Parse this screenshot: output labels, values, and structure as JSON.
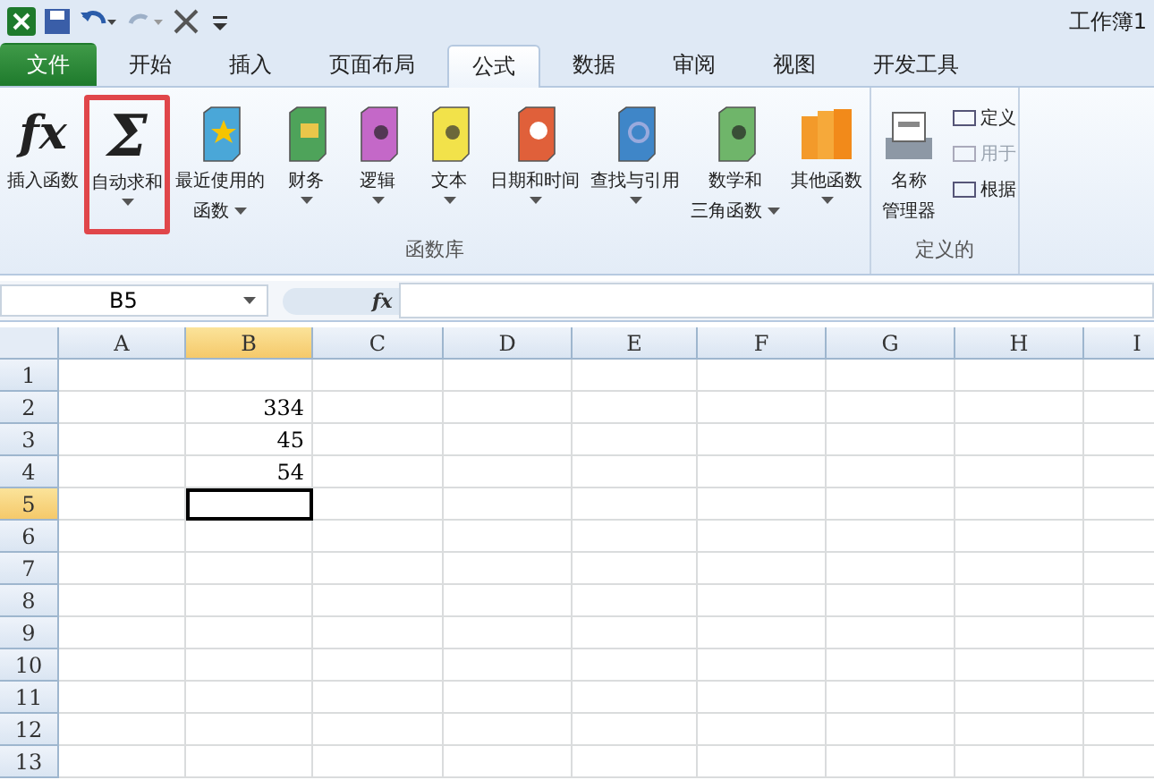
{
  "window": {
    "title": "工作簿1"
  },
  "tabs": [
    {
      "label": "文件",
      "kind": "file",
      "selected": false
    },
    {
      "label": "开始",
      "kind": "tab",
      "selected": false
    },
    {
      "label": "插入",
      "kind": "tab",
      "selected": false
    },
    {
      "label": "页面布局",
      "kind": "tab",
      "selected": false
    },
    {
      "label": "公式",
      "kind": "tab",
      "selected": true
    },
    {
      "label": "数据",
      "kind": "tab",
      "selected": false
    },
    {
      "label": "审阅",
      "kind": "tab",
      "selected": false
    },
    {
      "label": "视图",
      "kind": "tab",
      "selected": false
    },
    {
      "label": "开发工具",
      "kind": "tab",
      "selected": false
    }
  ],
  "ribbon": {
    "groups": [
      {
        "label": "函数库",
        "buttons": [
          {
            "lines": [
              "插入函数"
            ],
            "kind": "glyph",
            "glyph": "fx",
            "dropdown": false,
            "highlighted": false
          },
          {
            "lines": [
              "自动求和"
            ],
            "kind": "glyph",
            "glyph": "Σ",
            "dropdown": true,
            "highlighted": true
          },
          {
            "lines": [
              "最近使用的",
              "函数"
            ],
            "kind": "book-star",
            "dropdown": true,
            "highlighted": false
          },
          {
            "lines": [
              "财务"
            ],
            "kind": "book-money",
            "dropdown": true,
            "highlighted": false
          },
          {
            "lines": [
              "逻辑"
            ],
            "kind": "book-question",
            "dropdown": true,
            "highlighted": false
          },
          {
            "lines": [
              "文本"
            ],
            "kind": "book-letter",
            "dropdown": true,
            "highlighted": false
          },
          {
            "lines": [
              "日期和时间"
            ],
            "kind": "book-clock",
            "dropdown": true,
            "highlighted": false
          },
          {
            "lines": [
              "查找与引用"
            ],
            "kind": "book-search",
            "dropdown": true,
            "highlighted": false
          },
          {
            "lines": [
              "数学和",
              "三角函数"
            ],
            "kind": "book-theta",
            "dropdown": true,
            "highlighted": false
          },
          {
            "lines": [
              "其他函数"
            ],
            "kind": "books",
            "dropdown": true,
            "highlighted": false
          }
        ]
      },
      {
        "label": "定义的",
        "buttons": [
          {
            "lines": [
              "名称",
              "管理器"
            ],
            "kind": "card-file",
            "dropdown": false,
            "highlighted": false
          }
        ],
        "small_buttons": [
          {
            "label": "定义",
            "disabled": false
          },
          {
            "label": "用于",
            "disabled": true
          },
          {
            "label": "根据",
            "disabled": false
          }
        ]
      }
    ]
  },
  "formula_bar": {
    "name_box": "B5",
    "function_symbol": "fx"
  },
  "sheet": {
    "columns": [
      {
        "label": "A",
        "selected": false
      },
      {
        "label": "B",
        "selected": true
      },
      {
        "label": "C",
        "selected": false
      },
      {
        "label": "D",
        "selected": false
      },
      {
        "label": "E",
        "selected": false
      },
      {
        "label": "F",
        "selected": false
      },
      {
        "label": "G",
        "selected": false
      },
      {
        "label": "H",
        "selected": false
      },
      {
        "label": "I",
        "selected": false
      }
    ],
    "rows": [
      {
        "label": "1",
        "selected": false,
        "cells": [
          null,
          null,
          null,
          null,
          null,
          null,
          null,
          null,
          null
        ]
      },
      {
        "label": "2",
        "selected": false,
        "cells": [
          null,
          "334",
          null,
          null,
          null,
          null,
          null,
          null,
          null
        ]
      },
      {
        "label": "3",
        "selected": false,
        "cells": [
          null,
          "45",
          null,
          null,
          null,
          null,
          null,
          null,
          null
        ]
      },
      {
        "label": "4",
        "selected": false,
        "cells": [
          null,
          "54",
          null,
          null,
          null,
          null,
          null,
          null,
          null
        ]
      },
      {
        "label": "5",
        "selected": true,
        "cells": [
          null,
          null,
          null,
          null,
          null,
          null,
          null,
          null,
          null
        ]
      },
      {
        "label": "6",
        "selected": false,
        "cells": [
          null,
          null,
          null,
          null,
          null,
          null,
          null,
          null,
          null
        ]
      },
      {
        "label": "7",
        "selected": false,
        "cells": [
          null,
          null,
          null,
          null,
          null,
          null,
          null,
          null,
          null
        ]
      },
      {
        "label": "8",
        "selected": false,
        "cells": [
          null,
          null,
          null,
          null,
          null,
          null,
          null,
          null,
          null
        ]
      },
      {
        "label": "9",
        "selected": false,
        "cells": [
          null,
          null,
          null,
          null,
          null,
          null,
          null,
          null,
          null
        ]
      },
      {
        "label": "10",
        "selected": false,
        "cells": [
          null,
          null,
          null,
          null,
          null,
          null,
          null,
          null,
          null
        ]
      },
      {
        "label": "11",
        "selected": false,
        "cells": [
          null,
          null,
          null,
          null,
          null,
          null,
          null,
          null,
          null
        ]
      },
      {
        "label": "12",
        "selected": false,
        "cells": [
          null,
          null,
          null,
          null,
          null,
          null,
          null,
          null,
          null
        ]
      },
      {
        "label": "13",
        "selected": false,
        "cells": [
          null,
          null,
          null,
          null,
          null,
          null,
          null,
          null,
          null
        ]
      }
    ]
  }
}
